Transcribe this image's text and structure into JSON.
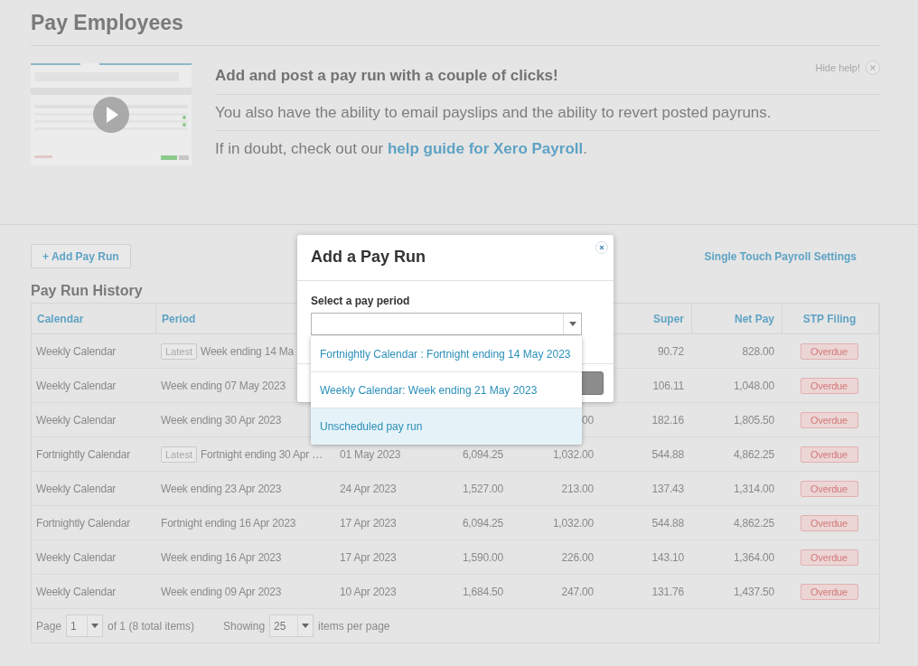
{
  "page": {
    "title": "Pay Employees"
  },
  "help": {
    "hide_label": "Hide help!",
    "headline": "Add and post a pay run with a couple of clicks!",
    "line": "You also have the ability to email payslips and the ability to revert posted payruns.",
    "tip_prefix": "If in doubt, check out our",
    "tip_link": "help guide for Xero Payroll",
    "tip_suffix": "."
  },
  "actions": {
    "add_button": "+ Add Pay Run",
    "settings_link": "Single Touch Payroll Settings"
  },
  "history": {
    "title": "Pay Run History",
    "columns": [
      {
        "label": "Calendar"
      },
      {
        "label": "Period"
      },
      {},
      {},
      {},
      {
        "label": "Super"
      },
      {
        "label": "Net Pay"
      },
      {
        "label": "STP Filing"
      }
    ],
    "rows": [
      {
        "cells": [
          "Weekly Calendar",
          "Week ending 14 Ma",
          null,
          null,
          null,
          "90.72",
          "828.00"
        ],
        "badge": "Latest",
        "status": {
          "label": "Overdue",
          "kind": "overdue"
        }
      },
      {
        "cells": [
          "Weekly Calendar",
          "Week ending 07 May 2023",
          null,
          null,
          null,
          "106.11",
          "1,048.00"
        ],
        "status": {
          "label": "Overdue",
          "kind": "overdue"
        }
      },
      {
        "cells": [
          "Weekly Calendar",
          "Week ending 30 Apr 2023",
          null,
          null,
          "00",
          "182.16",
          "1,805.50"
        ],
        "status": {
          "label": "Overdue",
          "kind": "overdue"
        }
      },
      {
        "cells": [
          "Fortnightly Calendar",
          "Fortnight ending 30 Apr …",
          "01 May 2023",
          "6,094.25",
          "1,032.00",
          "544.88",
          "4,862.25"
        ],
        "badge": "Latest",
        "status": {
          "label": "Overdue",
          "kind": "overdue"
        }
      },
      {
        "cells": [
          "Weekly Calendar",
          "Week ending 23 Apr 2023",
          "24 Apr 2023",
          "1,527.00",
          "213.00",
          "137.43",
          "1,314.00"
        ],
        "status": {
          "label": "Overdue",
          "kind": "overdue"
        }
      },
      {
        "cells": [
          "Fortnightly Calendar",
          "Fortnight ending 16 Apr 2023",
          "17 Apr 2023",
          "6,094.25",
          "1,032.00",
          "544.88",
          "4,862.25"
        ],
        "status": {
          "label": "Overdue",
          "kind": "overdue"
        }
      },
      {
        "cells": [
          "Weekly Calendar",
          "Week ending 16 Apr 2023",
          "17 Apr 2023",
          "1,590.00",
          "226.00",
          "143.10",
          "1,364.00"
        ],
        "status": {
          "label": "Overdue",
          "kind": "overdue"
        }
      },
      {
        "cells": [
          "Weekly Calendar",
          "Week ending 09 Apr 2023",
          "10 Apr 2023",
          "1,684.50",
          "247.00",
          "131.76",
          "1,437.50"
        ],
        "status": {
          "label": "Overdue",
          "kind": "overdue"
        }
      }
    ],
    "pager": {
      "page_label": "Page",
      "page_value": "1",
      "page_of": "of 1 (8 total items)",
      "showing_label": "Showing",
      "per_page_value": "25",
      "per_page_suffix": "items per page"
    }
  },
  "modal": {
    "title": "Add a Pay Run",
    "field_label": "Select a pay period",
    "options": [
      {
        "label": "Fortnightly Calendar : Fortnight ending 14 May 2023",
        "selected": false
      },
      {
        "label": "Weekly Calendar: Week ending 21 May 2023",
        "selected": false
      },
      {
        "label": "Unscheduled pay run",
        "selected": true
      }
    ]
  }
}
